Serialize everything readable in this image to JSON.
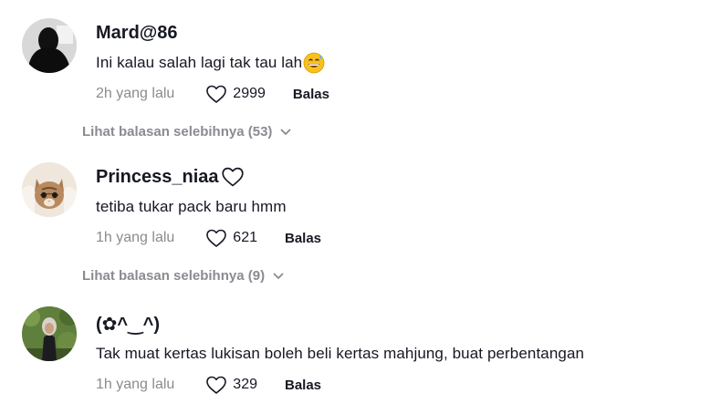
{
  "comments": [
    {
      "username": "Mard@86",
      "text": "Ini kalau salah lagi tak tau lah",
      "time": "2h yang lalu",
      "likes": "2999",
      "reply_label": "Balas",
      "text_emoji": "grinning-sweat-emoji",
      "avatar": "silhouette-avatar"
    },
    {
      "username": "Princess_niaa",
      "username_icon": "heart-outline-icon",
      "text": "tetiba tukar pack baru hmm",
      "time": "1h yang lalu",
      "likes": "621",
      "reply_label": "Balas",
      "avatar": "kitten-avatar"
    },
    {
      "username": "(✿^‿^)",
      "text": "Tak muat kertas lukisan boleh beli kertas mahjung, buat perbentangan",
      "time": "1h yang lalu",
      "likes": "329",
      "reply_label": "Balas",
      "avatar": "person-hijab-avatar"
    }
  ],
  "view_more": [
    {
      "label": "Lihat balasan selebihnya (53)",
      "icon": "chevron-down-icon"
    },
    {
      "label": "Lihat balasan selebihnya (9)",
      "icon": "chevron-down-icon"
    }
  ],
  "colors": {
    "text": "#161823",
    "muted": "#8a8b91",
    "background": "#ffffff"
  }
}
